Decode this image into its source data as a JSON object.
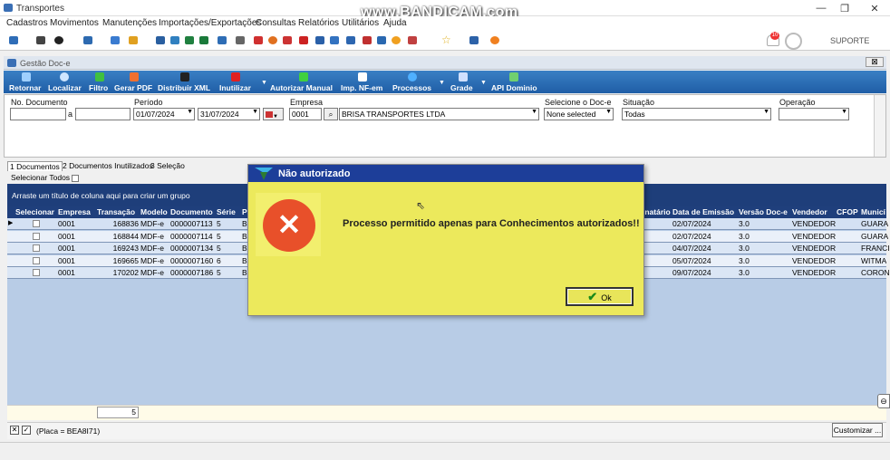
{
  "app": {
    "title": "Transportes",
    "watermark": "www.BANDICAM.com",
    "user": "SUPORTE",
    "notif_count": "10"
  },
  "menu": [
    "Cadastros",
    "Movimentos",
    "Manutenções",
    "Importações/Exportações",
    "Consultas",
    "Relatórios",
    "Utilitários",
    "Ajuda"
  ],
  "window": {
    "title": "Gestão Doc-e",
    "close": "⊠"
  },
  "ribbon": [
    "Retornar",
    "Localizar",
    "Filtro",
    "Gerar PDF",
    "Distribuir XML",
    "Inutilizar",
    "Autorizar Manual",
    "Imp. NF-em",
    "Processos",
    "Grade",
    "API Dominio"
  ],
  "filters": {
    "no_documento": "No. Documento",
    "a": "a",
    "periodo": "Período",
    "date_from": "01/07/2024",
    "date_to": "31/07/2024",
    "empresa": "Empresa",
    "empresa_code": "0001",
    "empresa_name": "BRISA TRANSPORTES LTDA",
    "selecione": "Selecione o Doc-e",
    "selecione_value": "None selected",
    "situacao": "Situação",
    "situacao_value": "Todas",
    "operacao": "Operação",
    "operacao_value": ""
  },
  "tabs": [
    "1 Documentos",
    "2 Documentos Inutilizados",
    "3 Seleção"
  ],
  "select_all": "Selecionar Todos",
  "group_hint": "Arraste um título de coluna aqui para criar um grupo",
  "columns": [
    "Selecionar",
    "Empresa",
    "Transação",
    "Modelo",
    "Documento",
    "Série",
    "P",
    "inatário",
    "Data de Emissão",
    "Versão Doc-e",
    "Vendedor",
    "CFOP",
    "Municí"
  ],
  "rows": [
    {
      "empresa": "0001",
      "transacao": "168836",
      "modelo": "MDF-e",
      "documento": "0000007113",
      "serie": "5",
      "p": "B",
      "data": "02/07/2024",
      "versao": "3.0",
      "vendedor": "VENDEDOR",
      "munic": "GUARA"
    },
    {
      "empresa": "0001",
      "transacao": "168844",
      "modelo": "MDF-e",
      "documento": "0000007114",
      "serie": "5",
      "p": "B",
      "data": "02/07/2024",
      "versao": "3.0",
      "vendedor": "VENDEDOR",
      "munic": "GUARA"
    },
    {
      "empresa": "0001",
      "transacao": "169243",
      "modelo": "MDF-e",
      "documento": "0000007134",
      "serie": "5",
      "p": "B",
      "data": "04/07/2024",
      "versao": "3.0",
      "vendedor": "VENDEDOR",
      "munic": "FRANCI"
    },
    {
      "empresa": "0001",
      "transacao": "169665",
      "modelo": "MDF-e",
      "documento": "0000007160",
      "serie": "6",
      "p": "B",
      "data": "05/07/2024",
      "versao": "3.0",
      "vendedor": "VENDEDOR",
      "munic": "WITMA"
    },
    {
      "empresa": "0001",
      "transacao": "170202",
      "modelo": "MDF-e",
      "documento": "0000007186",
      "serie": "5",
      "p": "B",
      "data": "09/07/2024",
      "versao": "3.0",
      "vendedor": "VENDEDOR",
      "munic": "CORON"
    }
  ],
  "footer": {
    "count": "5",
    "filter_text": "(Placa = BEA8I71)",
    "customize": "Customizar ..."
  },
  "dialog": {
    "title": "Não autorizado",
    "message": "Processo permitido apenas para Conhecimentos autorizados!!",
    "ok": "Ok"
  },
  "colors": {
    "ribbon": "#2a6cb6",
    "grid_header": "#1f3f7c",
    "dialog_bg": "#ece95c",
    "dialog_head": "#1d3e99",
    "error": "#e8502a"
  }
}
